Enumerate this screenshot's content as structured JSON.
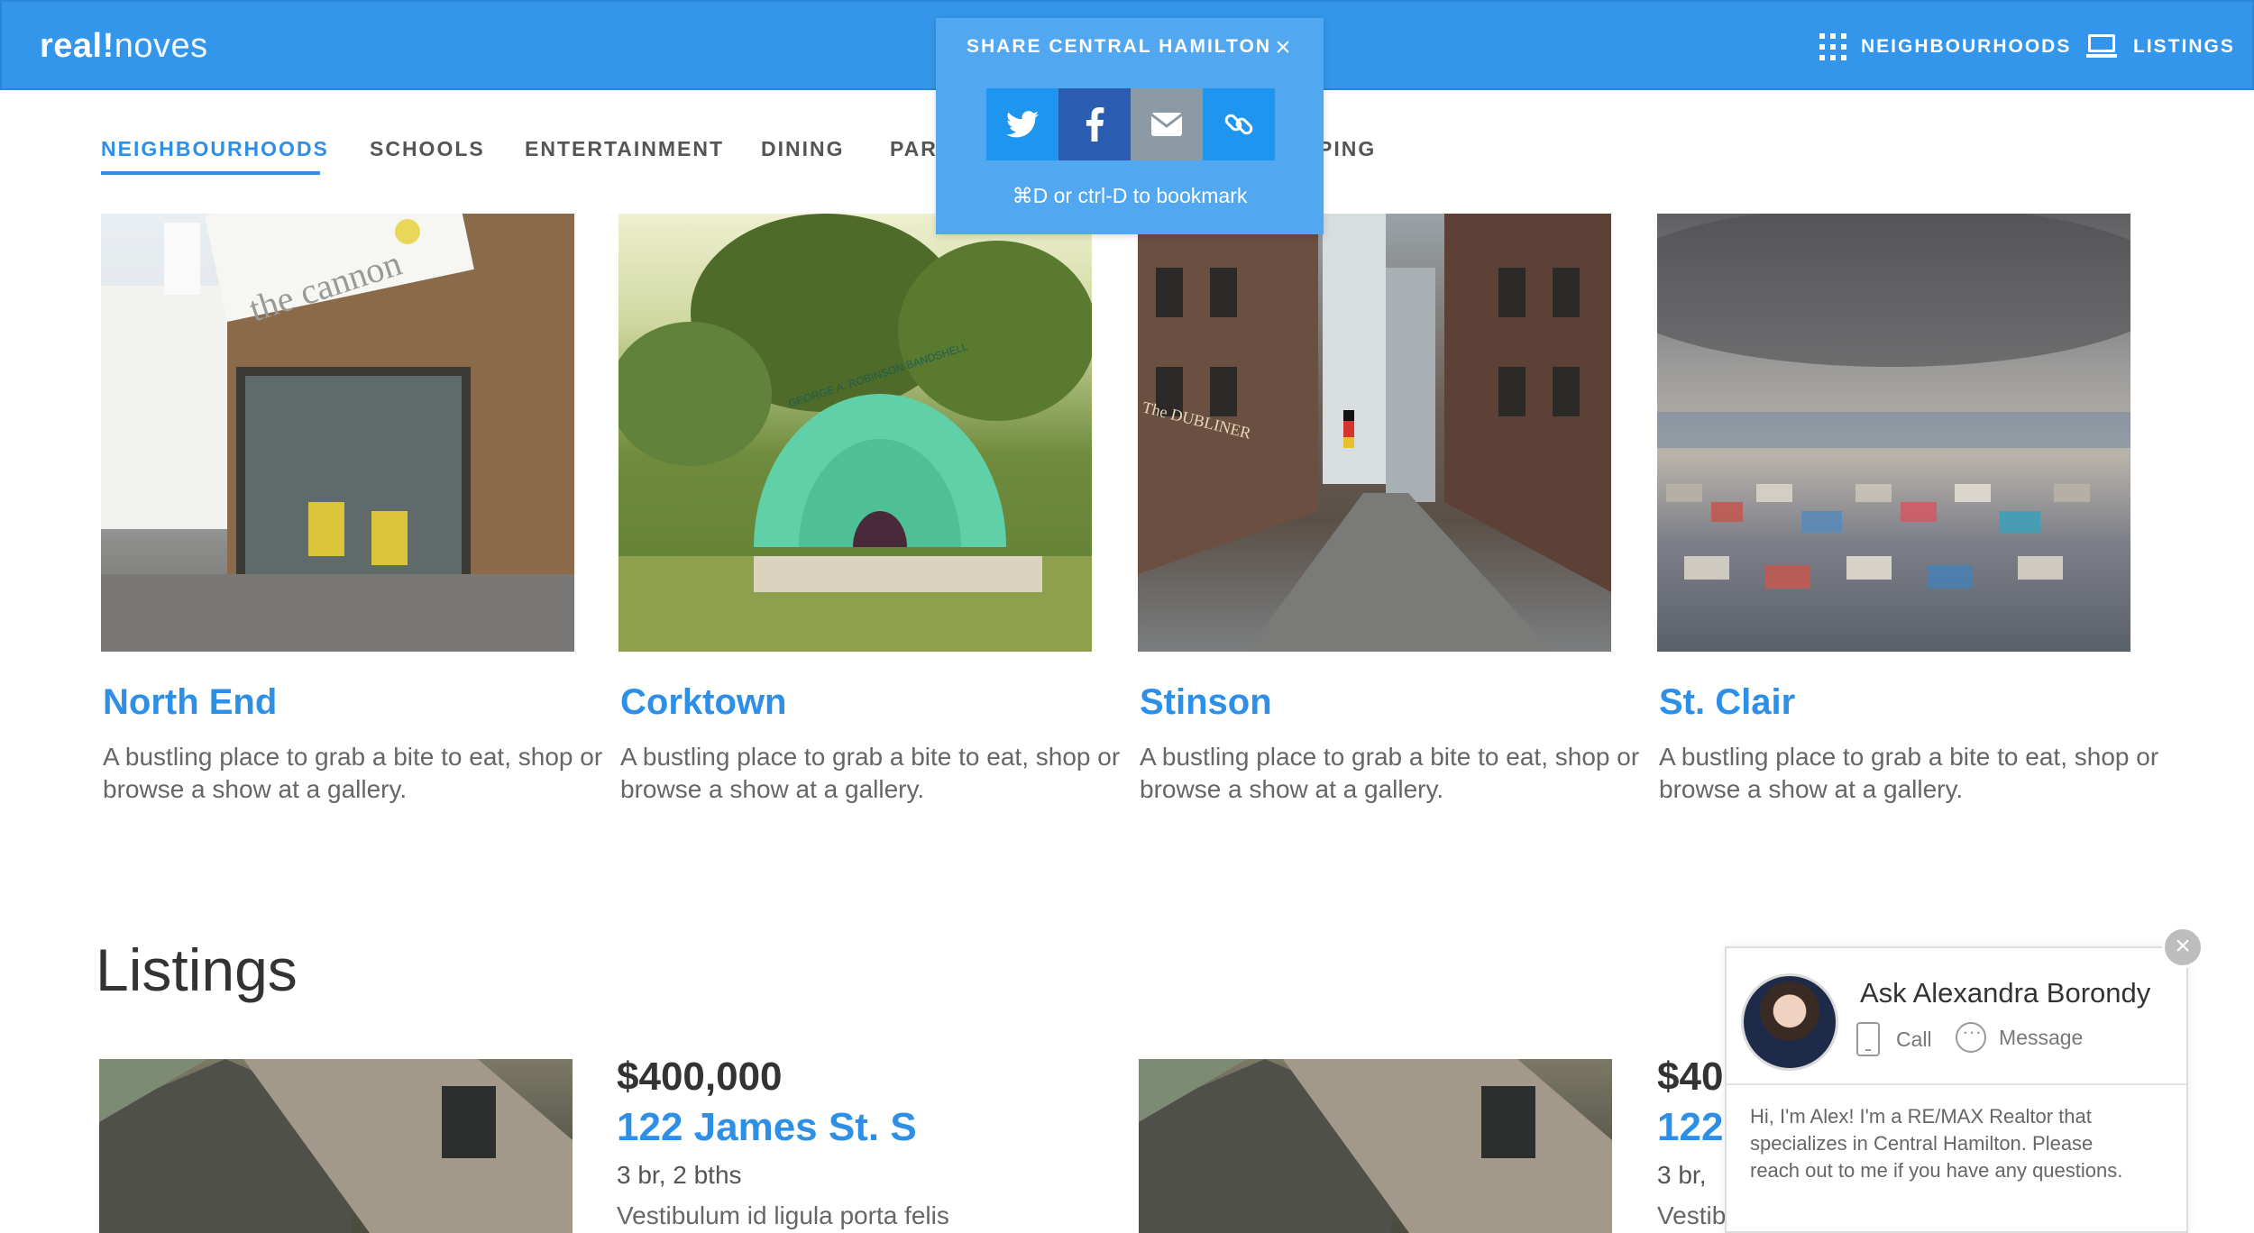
{
  "header": {
    "logo_part1": "real",
    "logo_part2": "noves",
    "nav": [
      {
        "label": "NEIGHBOURHOODS",
        "icon": "grid-icon"
      },
      {
        "label": "LISTINGS",
        "icon": "laptop-icon"
      }
    ]
  },
  "subnav": {
    "items": [
      "NEIGHBOURHOODS",
      "SCHOOLS",
      "ENTERTAINMENT",
      "DINING",
      "PAR",
      "PING"
    ],
    "active": "NEIGHBOURHOODS"
  },
  "share_popup": {
    "title": "SHARE CENTRAL HAMILTON",
    "close": "×",
    "buttons": [
      "twitter-icon",
      "facebook-icon",
      "email-icon",
      "link-icon"
    ],
    "hint": "⌘D or ctrl-D to bookmark"
  },
  "neighbourhoods": [
    {
      "name": "North End",
      "description": "A bustling place to grab a bite to eat, shop or browse a show at a gallery."
    },
    {
      "name": "Corktown",
      "description": "A bustling place to grab a bite to eat, shop or browse a show at a gallery."
    },
    {
      "name": "Stinson",
      "description": "A bustling place to grab a bite to eat, shop or browse a show at a gallery."
    },
    {
      "name": "St. Clair",
      "description": "A bustling place to grab a bite to eat, shop or browse a show at a gallery."
    }
  ],
  "photo_text": {
    "cannon_sign": "the cannon",
    "bandshell": "GEORGE A. ROBINSON BANDSHELL",
    "pub_sign": "The DUBLINER"
  },
  "listings": {
    "heading": "Listings",
    "items": [
      {
        "price": "$400,000",
        "address": "122 James St. S",
        "beds": "3 br, 2 bths",
        "desc": "Vestibulum id ligula porta felis"
      },
      {
        "price": "$40",
        "address": "122",
        "beds": "3 br,",
        "desc": "Vestib"
      }
    ]
  },
  "chat": {
    "name": "Ask Alexandra Borondy",
    "call_label": "Call",
    "message_label": "Message",
    "body": "Hi, I'm Alex!  I'm a RE/MAX Realtor that specializes in Central Hamilton. Please reach out to me if you have any questions.",
    "close": "×"
  },
  "colors": {
    "brand_blue": "#3496ea",
    "link_blue": "#2e8fe6",
    "twitter": "#1e95ee",
    "facebook": "#2a5db0",
    "email": "#8c9aa6"
  }
}
